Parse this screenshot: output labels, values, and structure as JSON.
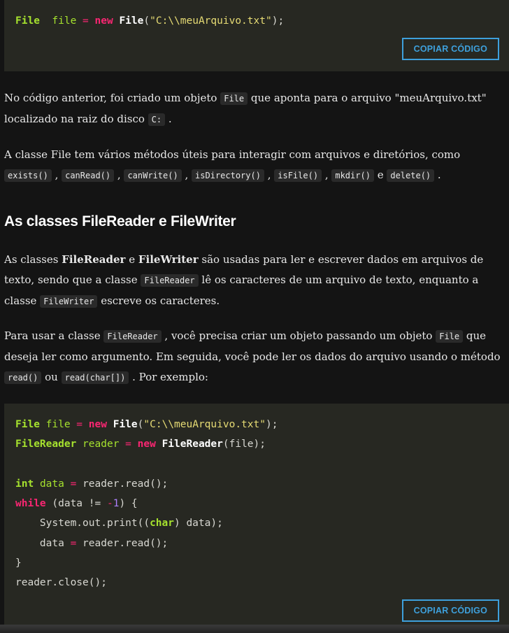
{
  "code_block_1": {
    "lines": [
      [
        [
          "ty",
          "File"
        ],
        [
          "",
          "  "
        ],
        [
          "var",
          "file"
        ],
        [
          "op",
          " = "
        ],
        [
          "kw",
          "new"
        ],
        [
          "",
          " "
        ],
        [
          "cls",
          "File"
        ],
        [
          "",
          "("
        ],
        [
          "str",
          "\"C:\\\\meuArquivo.txt\""
        ],
        [
          "",
          ");"
        ]
      ]
    ],
    "copy_label": "COPIAR CÓDIGO"
  },
  "p1": [
    "No código anterior, foi criado um objeto ",
    {
      "code": "File"
    },
    " que aponta para o arquivo \"meuArquivo.txt\" localizado na raiz do disco ",
    {
      "code": "C:"
    },
    " ."
  ],
  "p2": [
    "A classe File tem vários métodos úteis para interagir com arquivos e diretórios, como ",
    {
      "code": "exists()"
    },
    " , ",
    {
      "code": "canRead()"
    },
    " , ",
    {
      "code": "canWrite()"
    },
    " , ",
    {
      "code": "isDirectory()"
    },
    " , ",
    {
      "code": "isFile()"
    },
    " , ",
    {
      "code": "mkdir()"
    },
    " e ",
    {
      "code": "delete()"
    },
    " ."
  ],
  "heading": "As classes FileReader e FileWriter",
  "p3": [
    "As classes ",
    {
      "b": "FileReader"
    },
    " e ",
    {
      "b": "FileWriter"
    },
    " são usadas para ler e escrever dados em arquivos de texto, sendo que a classe ",
    {
      "code": "FileReader"
    },
    " lê os caracteres de um arquivo de texto, enquanto a classe ",
    {
      "code": "FileWriter"
    },
    " escreve os caracteres."
  ],
  "p4": [
    "Para usar a classe ",
    {
      "code": "FileReader"
    },
    " , você precisa criar um objeto passando um objeto ",
    {
      "code": "File"
    },
    " que deseja ler como argumento. Em seguida, você pode ler os dados do arquivo usando o método ",
    {
      "code": "read()"
    },
    " ou ",
    {
      "code": "read(char[])"
    },
    " . Por exemplo:"
  ],
  "code_block_2": {
    "lines": [
      [
        [
          "ty",
          "File"
        ],
        [
          "",
          " "
        ],
        [
          "var",
          "file"
        ],
        [
          "op",
          " = "
        ],
        [
          "kw",
          "new"
        ],
        [
          "",
          " "
        ],
        [
          "cls",
          "File"
        ],
        [
          "",
          "("
        ],
        [
          "str",
          "\"C:\\\\meuArquivo.txt\""
        ],
        [
          "",
          ");"
        ]
      ],
      [
        [
          "ty",
          "FileReader"
        ],
        [
          "",
          " "
        ],
        [
          "var",
          "reader"
        ],
        [
          "op",
          " = "
        ],
        [
          "kw",
          "new"
        ],
        [
          "",
          " "
        ],
        [
          "cls",
          "FileReader"
        ],
        [
          "",
          "(file);"
        ]
      ],
      [],
      [
        [
          "ty",
          "int"
        ],
        [
          "",
          " "
        ],
        [
          "var",
          "data"
        ],
        [
          "op",
          " = "
        ],
        [
          "",
          "reader.read();"
        ]
      ],
      [
        [
          "kw",
          "while"
        ],
        [
          "",
          " (data != "
        ],
        [
          "op",
          "-"
        ],
        [
          "num",
          "1"
        ],
        [
          "",
          ") {"
        ]
      ],
      [
        [
          "",
          "    System.out.print(("
        ],
        [
          "ty",
          "char"
        ],
        [
          "",
          ") data);"
        ]
      ],
      [
        [
          "",
          "    data "
        ],
        [
          "op",
          "="
        ],
        [
          "",
          " reader.read();"
        ]
      ],
      [
        [
          "",
          "}"
        ]
      ],
      [
        [
          "",
          "reader.close();"
        ]
      ]
    ],
    "copy_label": "COPIAR CÓDIGO"
  }
}
